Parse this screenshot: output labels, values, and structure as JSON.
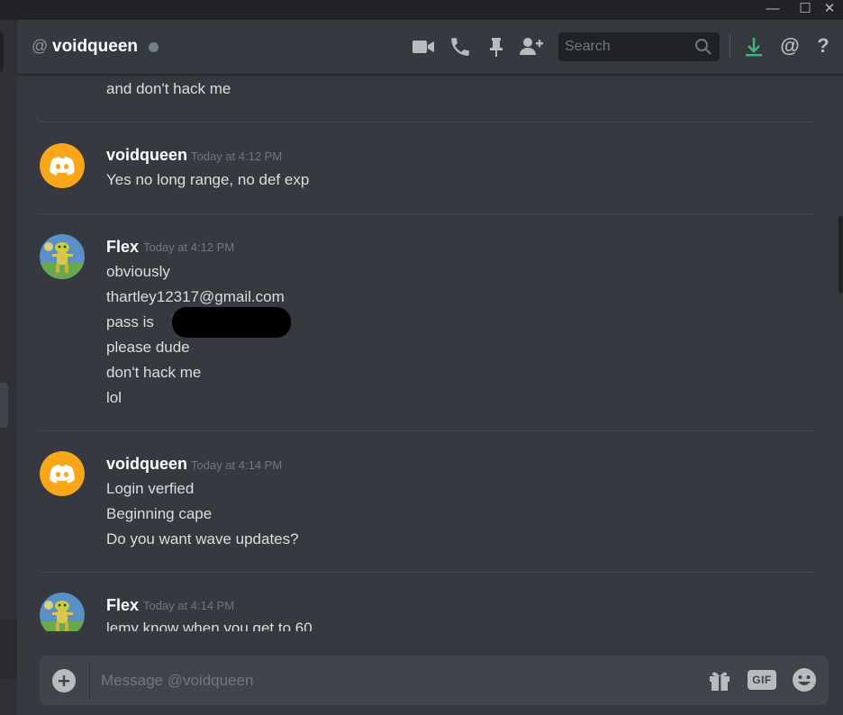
{
  "window": {
    "minimize_glyph": "—",
    "maximize_glyph": "☐",
    "close_glyph": "✕"
  },
  "header": {
    "at_symbol": "@",
    "username": "voidqueen",
    "status": "offline",
    "status_color": "#747f8d",
    "icons": [
      "video-call-icon",
      "voice-call-icon",
      "pin-icon",
      "add-friend-icon",
      "download-icon",
      "mention-icon",
      "help-icon"
    ],
    "search_placeholder": "Search",
    "help_glyph": "?",
    "mention_glyph": "@"
  },
  "messages": [
    {
      "type": "continuation",
      "lines": [
        "and don't hack me"
      ]
    },
    {
      "author": "voidqueen",
      "avatar": "discord-logo",
      "avatar_color": "#faa61a",
      "timestamp": "Today at 4:12 PM",
      "lines": [
        "Yes no long range, no def exp"
      ]
    },
    {
      "author": "Flex",
      "avatar": "pepe-image",
      "timestamp": "Today at 4:12 PM",
      "lines": [
        "obviously",
        "thartley12317@gmail.com",
        "pass is",
        "please dude",
        "don't hack me",
        "lol"
      ]
    },
    {
      "author": "voidqueen",
      "avatar": "discord-logo",
      "avatar_color": "#faa61a",
      "timestamp": "Today at 4:14 PM",
      "lines": [
        "Login verfied",
        "Beginning cape",
        "Do you want wave updates?"
      ]
    },
    {
      "author": "Flex",
      "avatar": "pepe-image",
      "timestamp": "Today at 4:14 PM",
      "lines": [
        "lemy know when you get to 60"
      ]
    }
  ],
  "composer": {
    "placeholder": "Message @voidqueen",
    "gif_label": "GIF",
    "icons": [
      "add-attachment-icon",
      "gift-icon",
      "emoji-icon"
    ]
  },
  "colors": {
    "download_accent": "#43b581",
    "background": "#36393f",
    "input_background": "#40444b"
  }
}
